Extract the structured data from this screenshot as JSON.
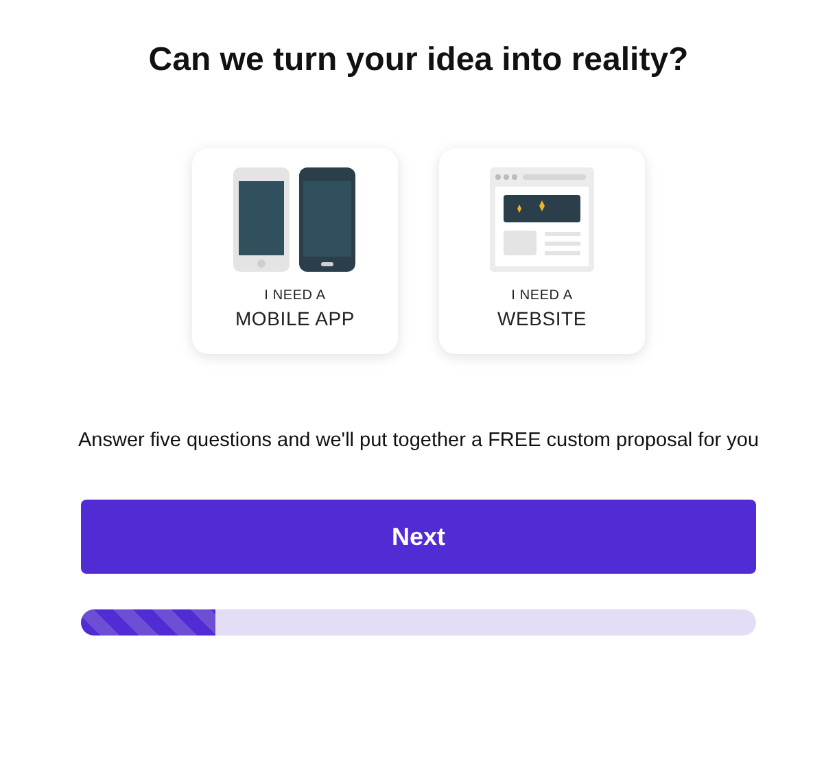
{
  "title": "Can we turn your idea into reality?",
  "options": [
    {
      "kind": "mobile",
      "prefix": "I NEED A",
      "label": "MOBILE APP"
    },
    {
      "kind": "website",
      "prefix": "I NEED A",
      "label": "WEBSITE"
    }
  ],
  "description": "Answer five questions and we'll put together a FREE custom proposal for you",
  "button": "Next",
  "progress": {
    "level": 0.2
  }
}
